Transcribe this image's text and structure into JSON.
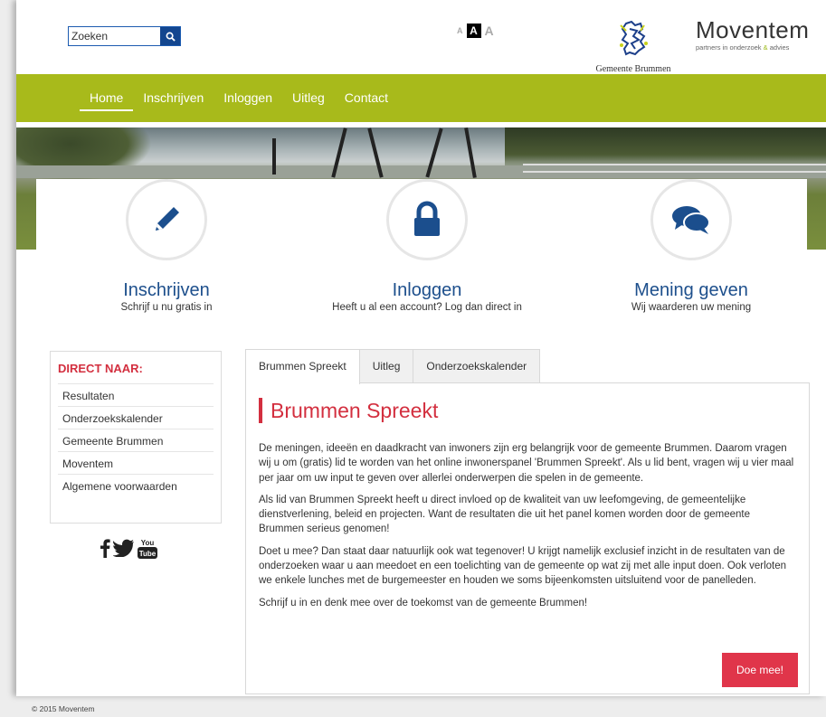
{
  "search": {
    "placeholder": "Zoeken"
  },
  "font_size": {
    "small": "A",
    "medium": "A",
    "large": "A"
  },
  "logos": {
    "gemeente": "Gemeente Brummen",
    "moventem_title": "Moventem",
    "moventem_tag_a": "partners in onderzoek ",
    "moventem_tag_amp": "&",
    "moventem_tag_b": " advies"
  },
  "nav": {
    "items": [
      {
        "label": "Home"
      },
      {
        "label": "Inschrijven"
      },
      {
        "label": "Inloggen"
      },
      {
        "label": "Uitleg"
      },
      {
        "label": "Contact"
      }
    ]
  },
  "features": [
    {
      "icon": "pencil-icon",
      "title": "Inschrijven",
      "subtitle": "Schrijf u nu gratis in"
    },
    {
      "icon": "lock-icon",
      "title": "Inloggen",
      "subtitle": "Heeft u al een account? Log dan direct in"
    },
    {
      "icon": "chat-icon",
      "title": "Mening geven",
      "subtitle": "Wij waarderen uw mening"
    }
  ],
  "sidebar": {
    "title": "DIRECT NAAR:",
    "items": [
      {
        "label": "Resultaten"
      },
      {
        "label": "Onderzoekskalender"
      },
      {
        "label": "Gemeente Brummen"
      },
      {
        "label": "Moventem"
      },
      {
        "label": "Algemene voorwaarden"
      }
    ]
  },
  "social": [
    "facebook-icon",
    "twitter-icon",
    "youtube-icon"
  ],
  "tabs": [
    {
      "label": "Brummen Spreekt"
    },
    {
      "label": "Uitleg"
    },
    {
      "label": "Onderzoekskalender"
    }
  ],
  "content": {
    "heading": "Brummen Spreekt",
    "paragraphs": [
      "De meningen, ideeën en daadkracht van inwoners zijn erg belangrijk voor de gemeente Brummen. Daarom vragen wij u om (gratis) lid te worden van het online inwonerspanel 'Brummen Spreekt'. Als u lid bent, vragen wij u vier maal per jaar om uw input te geven over allerlei onderwerpen die spelen in de gemeente.",
      "Als lid van Brummen Spreekt heeft u direct invloed op de kwaliteit van uw leefomgeving, de gemeentelijke dienstverlening, beleid en projecten. Want de resultaten die uit het panel komen worden door de gemeente Brummen serieus genomen!",
      "Doet u mee? Dan staat daar natuurlijk ook wat tegenover! U krijgt namelijk exclusief inzicht in de resultaten van de onderzoeken waar u aan meedoet en een toelichting van de gemeente op wat zij met alle input doen. Ook verloten we enkele lunches met de burgemeester en houden we soms bijeenkomsten uitsluitend voor de panelleden.",
      "Schrijf u in en denk mee over de toekomst van de gemeente Brummen!"
    ],
    "button": "Doe mee!"
  },
  "footer": {
    "copyright": "© 2015 Moventem"
  },
  "colors": {
    "nav_green": "#a8ba1b",
    "accent_red": "#d32f3f",
    "title_blue": "#1d4f8c",
    "button_red": "#e0354a"
  }
}
